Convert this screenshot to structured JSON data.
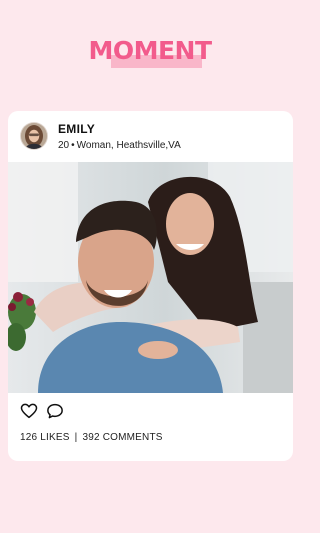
{
  "app": {
    "title": "MOMENT",
    "accent": "#f25b8c",
    "background": "#fde8ed"
  },
  "post": {
    "user": {
      "name": "EMILY",
      "age": "20",
      "gender": "Woman",
      "location": "Heathsville,VA"
    },
    "photo_icon": "couple-photo",
    "actions": {
      "like_icon": "heart-icon",
      "comment_icon": "comment-bubble-icon"
    },
    "stats": {
      "likes": "126 LIKES",
      "separator": "|",
      "comments": "392 COMMENTS"
    }
  }
}
